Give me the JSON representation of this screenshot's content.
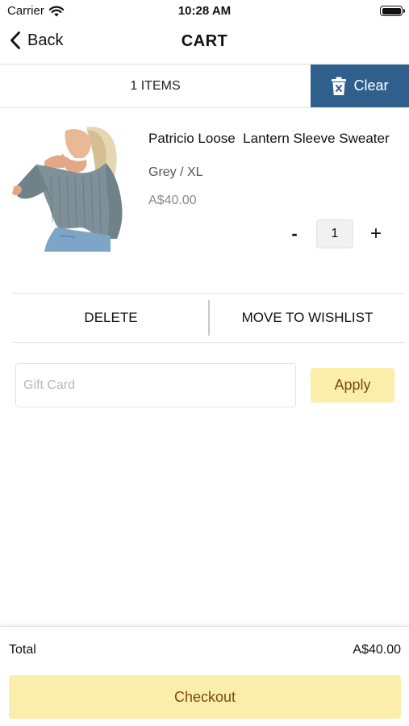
{
  "status_bar": {
    "carrier": "Carrier",
    "time": "10:28 AM",
    "wifi_icon": "wifi-icon",
    "battery_icon": "battery-icon"
  },
  "nav": {
    "back_label": "Back",
    "back_icon": "chevron-left-icon",
    "title": "CART"
  },
  "cart_bar": {
    "items_count": "1 ITEMS",
    "clear_label": "Clear",
    "clear_icon": "trash-icon",
    "clear_color": "#2e5f8d"
  },
  "item": {
    "name": "Patricio Loose  Lantern Sleeve Sweater",
    "variant": "Grey / XL",
    "price": "A$40.00",
    "image_icon": "sweater-product-image",
    "quantity": "1",
    "minus_label": "-",
    "plus_label": "+"
  },
  "item_actions": {
    "delete_label": "DELETE",
    "wishlist_label": "MOVE TO WISHLIST"
  },
  "gift_card": {
    "placeholder": "Gift Card",
    "value": "",
    "apply_label": "Apply"
  },
  "footer": {
    "total_label": "Total",
    "total_value": "A$40.00",
    "checkout_label": "Checkout"
  },
  "colors": {
    "accent_yellow": "#fbeeaa",
    "accent_text": "#7a4b12",
    "clear_blue": "#2e5f8d"
  }
}
